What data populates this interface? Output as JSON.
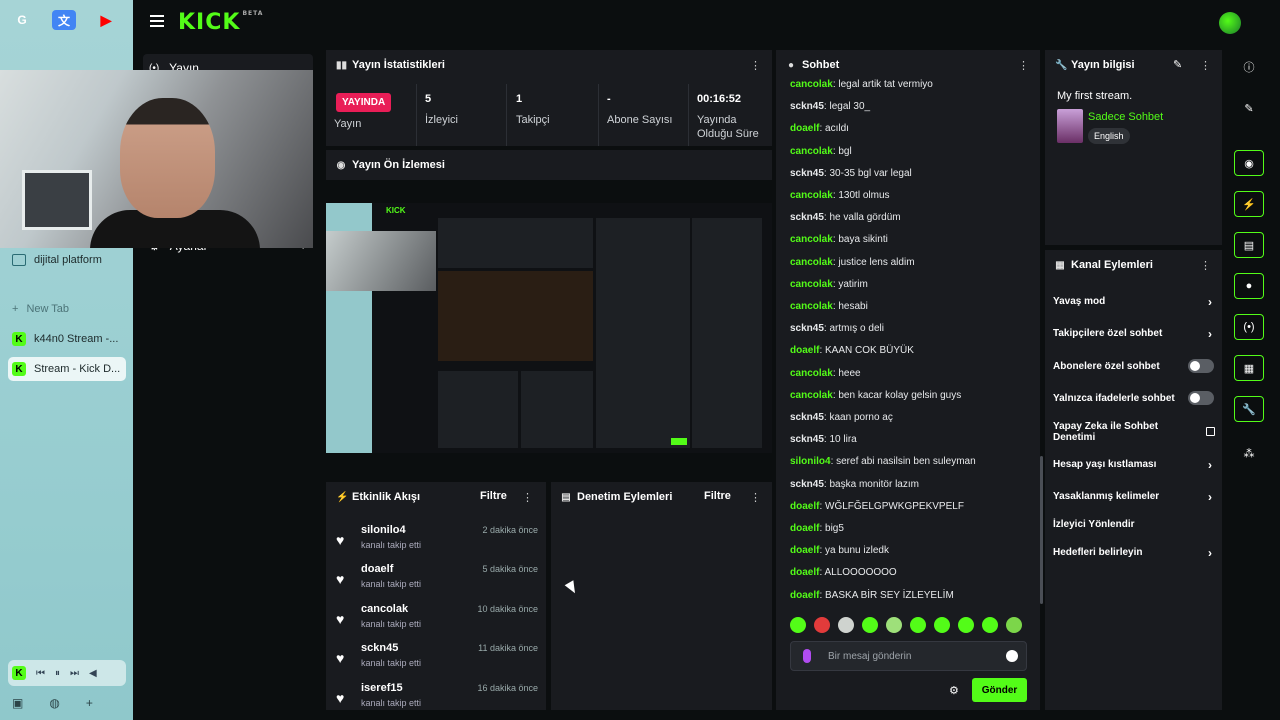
{
  "browser": {
    "favicons": [
      {
        "name": "google-icon",
        "glyph": "G",
        "color": "#ffffff"
      },
      {
        "name": "translate-icon",
        "glyph": "文",
        "color": "#4285f4"
      },
      {
        "name": "youtube-icon",
        "glyph": "▶",
        "color": "#ff0000"
      }
    ],
    "tabs": [
      {
        "label": "dijital platform",
        "type": "folder"
      },
      {
        "label": "New Tab",
        "type": "new"
      },
      {
        "label": "k44n0 Stream -...",
        "type": "kick"
      },
      {
        "label": "Stream - Kick D...",
        "type": "kick"
      }
    ]
  },
  "nav": {
    "logo": "KICK",
    "logo_badge": "BETA"
  },
  "menu": {
    "item1": "Yayın",
    "item2": "Ayarlar"
  },
  "stats": {
    "title": "Yayın İstatistikleri",
    "live_label": "YAYINDA",
    "live_sub": "Yayın",
    "viewers_value": "5",
    "viewers_label": "İzleyici",
    "followers_value": "1",
    "followers_label": "Takipçi",
    "subs_value": "-",
    "subs_label": "Abone Sayısı",
    "duration_value": "00:16:52",
    "duration_label_1": "Yayında",
    "duration_label_2": "Olduğu Süre"
  },
  "preview": {
    "title": "Yayın Ön İzlemesi"
  },
  "activity": {
    "title": "Etkinlik Akışı",
    "filter": "Filtre",
    "items": [
      {
        "name": "silonilo4",
        "sub": "kanalı takip etti",
        "time": "2 dakika önce"
      },
      {
        "name": "doaelf",
        "sub": "kanalı takip etti",
        "time": "5 dakika önce"
      },
      {
        "name": "cancolak",
        "sub": "kanalı takip etti",
        "time": "10 dakika önce"
      },
      {
        "name": "sckn45",
        "sub": "kanalı takip etti",
        "time": "11 dakika önce"
      },
      {
        "name": "iseref15",
        "sub": "kanalı takip etti",
        "time": "16 dakika önce"
      }
    ]
  },
  "moderation": {
    "title": "Denetim Eylemleri",
    "filter": "Filtre"
  },
  "chat": {
    "title": "Sohbet",
    "user_colors": {
      "cancolak": "#53fc18",
      "sckn45": "#e8eaec",
      "doaelf": "#53fc18",
      "silonilo4": "#53fc18"
    },
    "messages": [
      {
        "user": "cancolak",
        "text": "legal artik tat vermiyo"
      },
      {
        "user": "sckn45",
        "text": "legal 30_"
      },
      {
        "user": "doaelf",
        "text": "acıldı"
      },
      {
        "user": "cancolak",
        "text": "bgl"
      },
      {
        "user": "sckn45",
        "text": "30-35 bgl var legal"
      },
      {
        "user": "cancolak",
        "text": "130tl olmus"
      },
      {
        "user": "sckn45",
        "text": "he valla gördüm"
      },
      {
        "user": "cancolak",
        "text": "baya sikinti"
      },
      {
        "user": "cancolak",
        "text": "justice lens aldim"
      },
      {
        "user": "cancolak",
        "text": "yatirim"
      },
      {
        "user": "cancolak",
        "text": "hesabi"
      },
      {
        "user": "sckn45",
        "text": "artmış o deli"
      },
      {
        "user": "doaelf",
        "text": "KAAN COK BÜYÜK"
      },
      {
        "user": "cancolak",
        "text": "heee"
      },
      {
        "user": "cancolak",
        "text": "ben kacar kolay gelsin guys"
      },
      {
        "user": "sckn45",
        "text": "kaan porno aç"
      },
      {
        "user": "sckn45",
        "text": "10 lira"
      },
      {
        "user": "silonilo4",
        "text": "seref abi nasilsin ben suleyman"
      },
      {
        "user": "sckn45",
        "text": "başka monitör lazım"
      },
      {
        "user": "doaelf",
        "text": "WĞLFĞELGPWKGPEKVPELF"
      },
      {
        "user": "doaelf",
        "text": "big5"
      },
      {
        "user": "doaelf",
        "text": "ya bunu izledk"
      },
      {
        "user": "doaelf",
        "text": "ALLOOOOOOO"
      },
      {
        "user": "doaelf",
        "text": "BASKA BİR SEY İZLEYELİM"
      }
    ],
    "placeholder": "Bir mesaj gönderin",
    "send": "Gönder"
  },
  "info": {
    "title": "Yayın bilgisi",
    "stream_title": "My first stream.",
    "category": "Sadece Sohbet",
    "language": "English"
  },
  "channel_actions": {
    "title": "Kanal Eylemleri",
    "items": [
      {
        "label": "Yavaş mod",
        "control": "chevron"
      },
      {
        "label": "Takipçilere özel sohbet",
        "control": "chevron"
      },
      {
        "label": "Abonelere özel sohbet",
        "control": "toggle"
      },
      {
        "label": "Yalnızca ifadelerle sohbet",
        "control": "toggle"
      },
      {
        "label": "Yapay Zeka ile Sohbet Denetimi",
        "control": "external"
      },
      {
        "label": "Hesap yaşı kıstlaması",
        "control": "chevron"
      },
      {
        "label": "Yasaklanmış kelimeler",
        "control": "chevron"
      },
      {
        "label": "İzleyici Yönlendir",
        "control": "none"
      },
      {
        "label": "Hedefleri belirleyin",
        "control": "chevron"
      }
    ]
  },
  "colors": {
    "accent": "#53fc18",
    "live": "#e91e57",
    "panel": "#191b1f",
    "bg": "#0b0e0f"
  }
}
